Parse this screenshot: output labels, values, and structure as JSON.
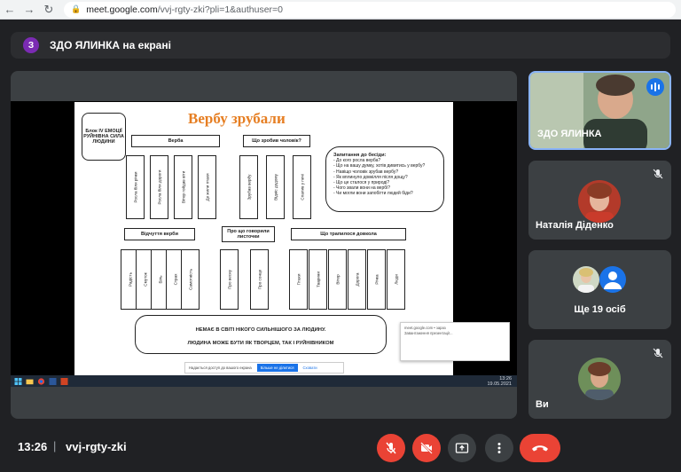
{
  "browser": {
    "url_host": "meet.google.com",
    "url_path": "/vvj-rgty-zki?pli=1&authuser=0"
  },
  "banner": {
    "avatar_letter": "З",
    "text": "ЗДО ЯЛИНКА на екрані"
  },
  "slide": {
    "title": "Вербу зрубали",
    "block_label": "Блок IV ЕМОЦІЇ РУЙНІВНА СИЛА ЛЮДИНИ",
    "verba_label": "Верба",
    "what_did_label": "Що зробив чоловік?",
    "verba_cols": [
      "Росла біля річки",
      "Росла біля дороги",
      "Вітер гойдав віти",
      "Де жили птахи"
    ],
    "man_cols": [
      "Зрубав вербу",
      "Відніс додому",
      "Спалив у печі"
    ],
    "questions_title": "Запитання до бесіди:",
    "questions": [
      "- До кого росла верба?",
      "- Що на вашу думку, хотів дивитись у вербу?",
      "- Навіщо чоловік зрубав вербу?",
      "- Як вплинуло довкілля після дощу?",
      "- Що це сталося у природі?",
      "- Чого звали вони на вербі?",
      "- Чи могли вони запобігти людей біди?"
    ],
    "feel_label": "Відчуття верби",
    "leaves_label": "Про що говорили листочки",
    "env_label": "Що трапилося довкола",
    "feel_cols": [
      "Радість",
      "Смуток",
      "Біль",
      "Страх",
      "Самотність"
    ],
    "leaves_cols": [
      "Про весну",
      "Про сонце"
    ],
    "env_cols": [
      "Птахи",
      "Тварини",
      "Вітер",
      "Дорога",
      "Річка",
      "Люди"
    ],
    "bottom_line1": "НЕМАЄ В СВІТІ НІКОГО СИЛЬНІШОГО ЗА ЛЮДИНУ.",
    "bottom_line2": "ЛЮДИНА МОЖЕ БУТИ ЯК ТВОРЦЕМ, ТАК І РУЙНІВНИКОМ",
    "share_bar_text": "Надається доступ до вашого екрана",
    "share_bar_stop": "Більше не ділитися",
    "share_bar_hide": "Сховати",
    "notif_title": "meet.google.com • зараз",
    "notif_text": "Завантаження презентації...",
    "taskbar_time": "13:26",
    "taskbar_date": "19.05.2021"
  },
  "tiles": [
    {
      "name": "ЗДО ЯЛИНКА",
      "state": "speaking"
    },
    {
      "name": "Наталія Діденко",
      "state": "muted"
    },
    {
      "name": "Ще 19 осіб",
      "state": "group"
    },
    {
      "name": "Ви",
      "state": "muted"
    }
  ],
  "meeting": {
    "time": "13:26",
    "separator": "|",
    "code": "vvj-rgty-zki"
  },
  "controls": {
    "mic": "mic-off-icon",
    "camera": "camera-off-icon",
    "present": "present-icon",
    "more": "more-vert-icon",
    "end": "call-end-icon"
  },
  "colors": {
    "accent": "#1a73e8",
    "danger": "#ea4335",
    "background": "#202124",
    "tile": "#3c4043",
    "title_orange": "#e67e22"
  }
}
